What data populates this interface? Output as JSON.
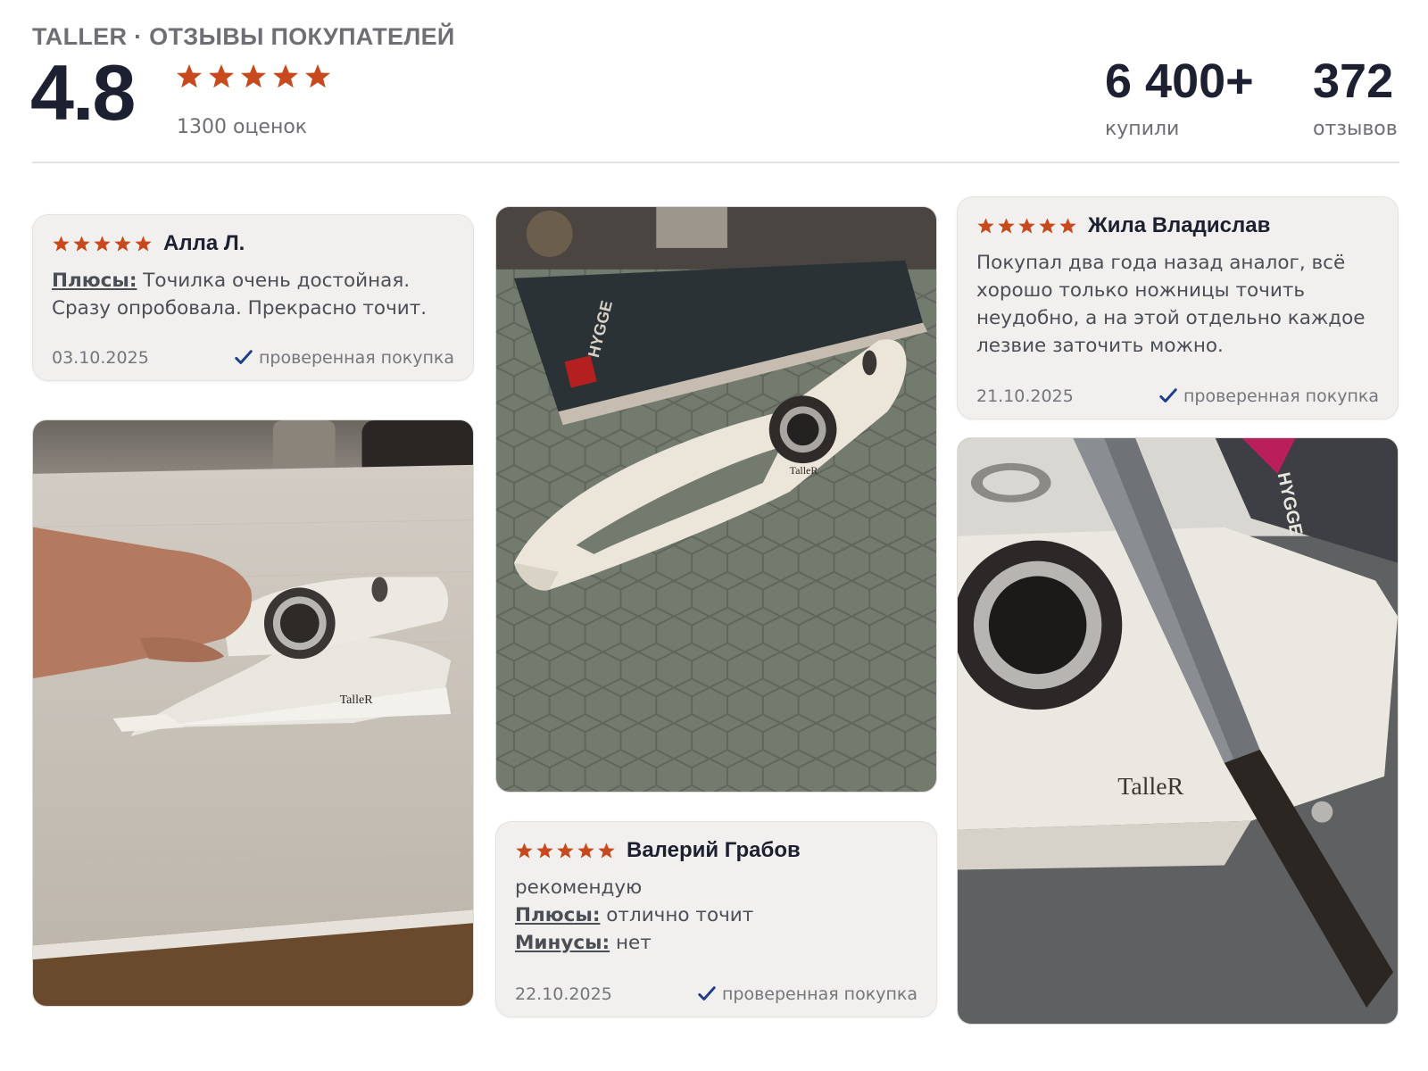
{
  "header": {
    "brand_title": "TALLER · ОТЗЫВЫ ПОКУПАТЕЛЕЙ",
    "rating": "4.8",
    "stars": 5,
    "rating_count": "1300 оценок",
    "stats": {
      "buyers_value": "6 400+",
      "buyers_label": "купили",
      "reviews_value": "372",
      "reviews_label": "отзывов"
    }
  },
  "colors": {
    "star": "#c7491d",
    "check": "#1d3d8c",
    "card_bg": "#f1f0ee"
  },
  "reviews": [
    {
      "author": "Алла Л.",
      "stars": 5,
      "pros_label": "Плюсы:",
      "pros_text": "Точилка очень достойная. Сразу опробовала. Прекрасно точит.",
      "date": "03.10.2025",
      "verified": "проверенная покупка"
    },
    {
      "author": "Валерий Грабов",
      "stars": 5,
      "comment": "рекомендую",
      "pros_label": "Плюсы:",
      "pros_text": "отлично точит",
      "cons_label": "Минусы:",
      "cons_text": "нет",
      "date": "22.10.2025",
      "verified": "проверенная покупка"
    },
    {
      "author": "Жила Владислав",
      "stars": 5,
      "comment": "Покупал два года назад аналог, всё хорошо только ножницы точить неудобно, а на этой отдельно каждое лезвие заточить можно.",
      "date": "21.10.2025",
      "verified": "проверенная покупка"
    }
  ],
  "photos": [
    {
      "brand_mark": "TalleR"
    },
    {
      "brand_mark": "TalleR",
      "box_label": "HYGGE"
    },
    {
      "brand_mark": "TalleR",
      "box_label": "HYGGE"
    }
  ]
}
